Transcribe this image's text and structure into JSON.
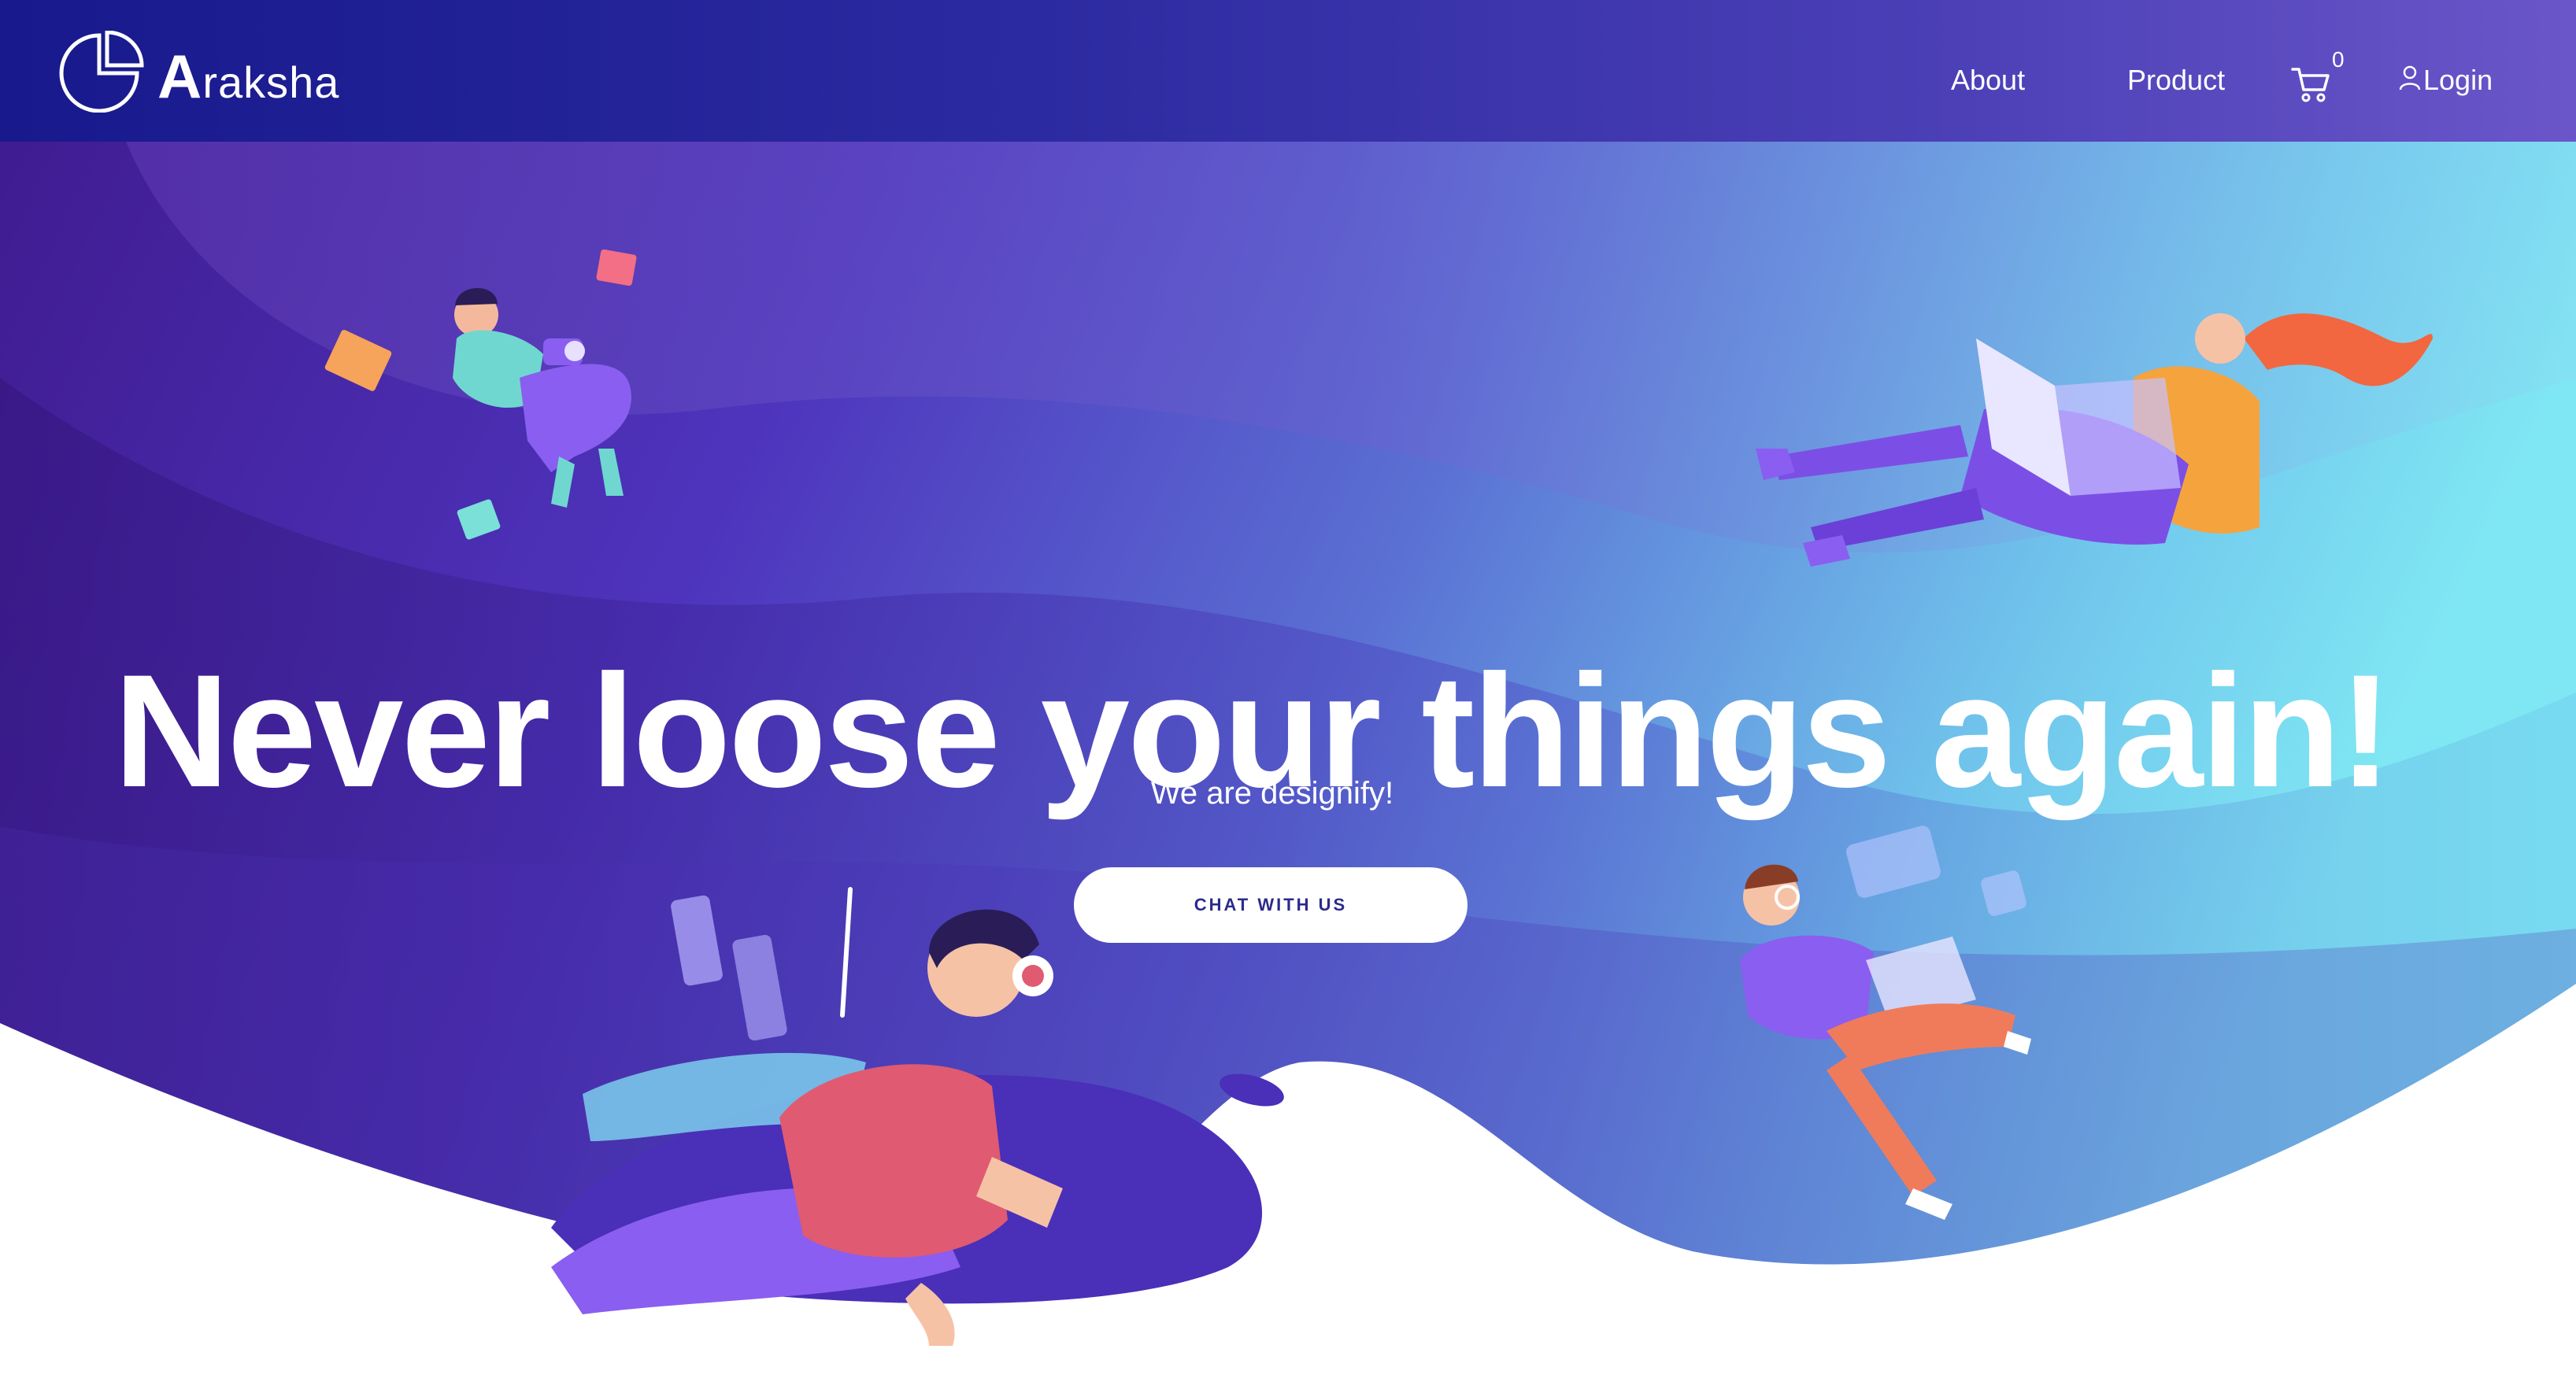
{
  "nav": {
    "brand_initial": "A",
    "brand_rest": "raksha",
    "about_label": "About",
    "product_label": "Product",
    "cart_count": "0",
    "login_label": "Login"
  },
  "hero": {
    "headline": "Never loose your things again!",
    "subline": "We are designify!",
    "cta_label": "CHAT WITH US"
  },
  "icons": {
    "logo": "pie-chart-logo-icon",
    "cart": "shopping-cart-icon",
    "user": "user-icon"
  },
  "colors": {
    "nav_start": "#17198c",
    "nav_end": "#6a56c9",
    "hero_purple": "#4c2fb5",
    "hero_cyan": "#7ee3f2",
    "cta_text": "#2b2a8c"
  }
}
